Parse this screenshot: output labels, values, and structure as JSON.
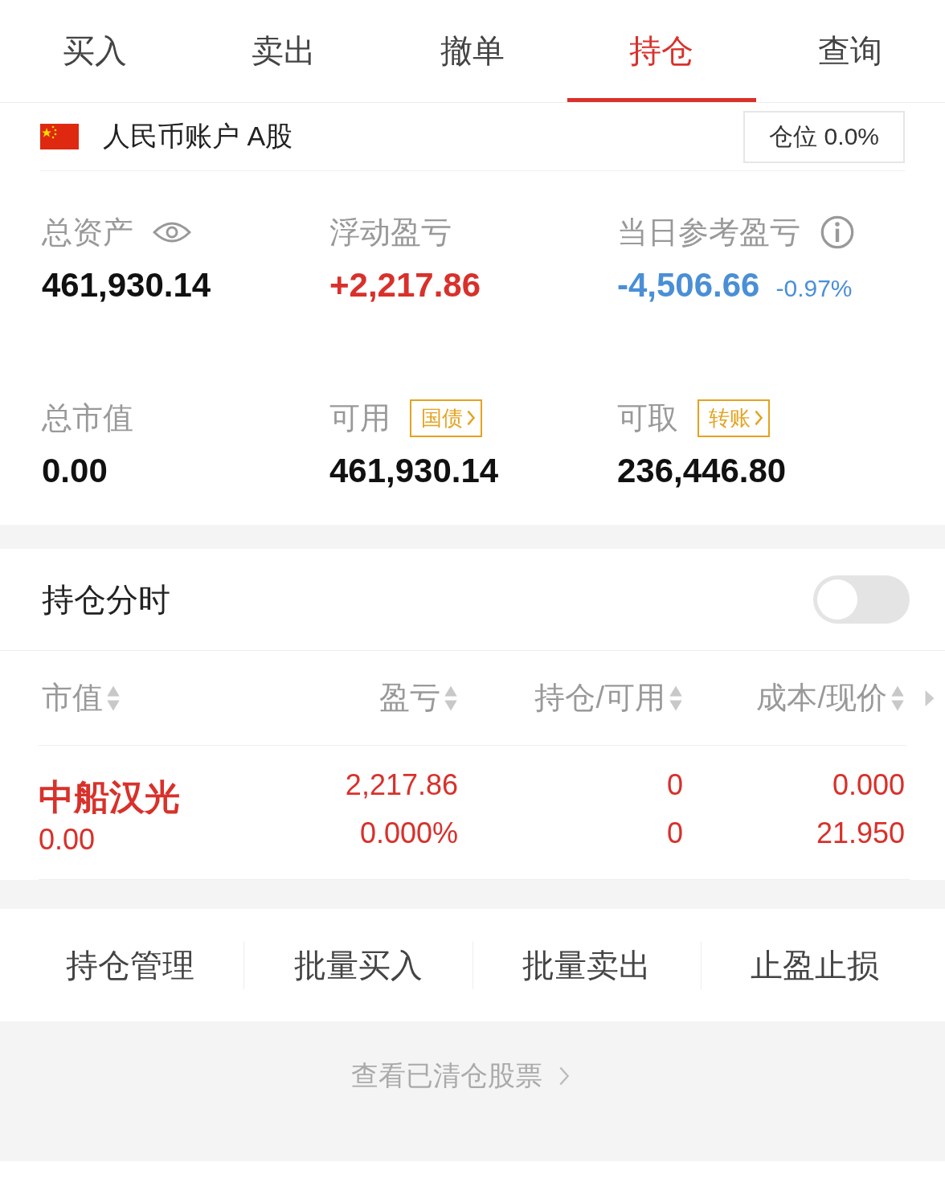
{
  "tabs": [
    {
      "label": "买入",
      "selected": false
    },
    {
      "label": "卖出",
      "selected": false
    },
    {
      "label": "撤单",
      "selected": false
    },
    {
      "label": "持仓",
      "selected": true
    },
    {
      "label": "查询",
      "selected": false
    }
  ],
  "account": {
    "name": "人民币账户 A股",
    "position": "仓位 0.0%"
  },
  "stats": [
    {
      "kind": "eye",
      "label": "总资产",
      "value": "461,930.14",
      "color": "#111111"
    },
    {
      "kind": "plain",
      "label": "浮动盈亏",
      "value": "+2,217.86",
      "color": "#d8312b"
    },
    {
      "kind": "info",
      "label": "当日参考盈亏",
      "value": "-4,506.66",
      "change": "-0.97%",
      "color": "#4a8fd6"
    },
    {
      "kind": "plain",
      "label": "总市值",
      "value": "0.00",
      "color": "#111111"
    },
    {
      "kind": "badge",
      "label": "可用",
      "badge": "国债",
      "value": "461,930.14",
      "color": "#111111"
    },
    {
      "kind": "badge",
      "label": "可取",
      "badge": "转账",
      "value": "236,446.80",
      "color": "#111111"
    }
  ],
  "toggle": {
    "label": "持仓分时",
    "on": false
  },
  "table": {
    "columns": [
      {
        "label": "市值"
      },
      {
        "label": "盈亏"
      },
      {
        "label": "持仓/可用"
      },
      {
        "label": "成本/现价"
      }
    ],
    "rows": [
      {
        "name": "中船汉光",
        "market_value": "0.00",
        "pnl": "2,217.86",
        "pnl_pct": "0.000%",
        "holding": "0",
        "available": "0",
        "cost": "0.000",
        "price": "21.950"
      }
    ]
  },
  "actions": [
    "持仓管理",
    "批量买入",
    "批量卖出",
    "止盈止损"
  ],
  "footer_link": "查看已清仓股票"
}
